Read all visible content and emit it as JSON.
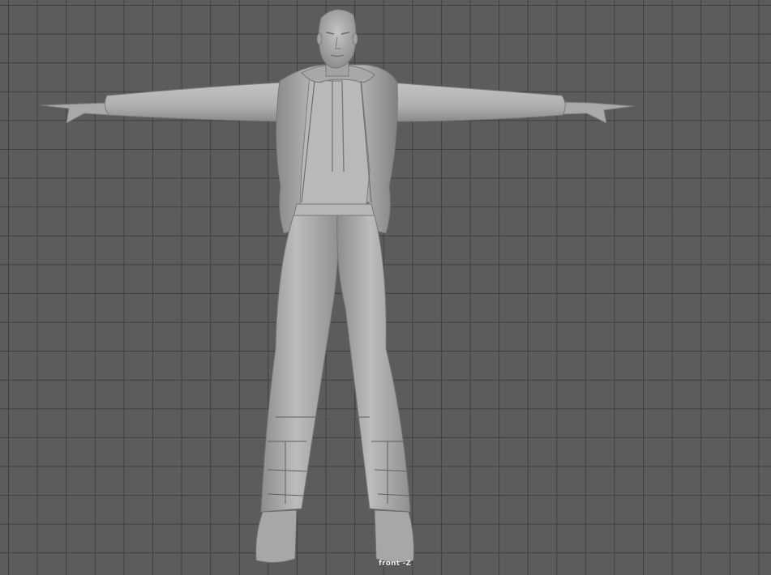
{
  "viewport": {
    "camera_label": "front -Z",
    "grid_visible": true,
    "background_color": "#5c5c5c",
    "grid_line_color": "#3f3f3f",
    "shading": "smooth-shade",
    "model_color": "#b5b5b5"
  }
}
